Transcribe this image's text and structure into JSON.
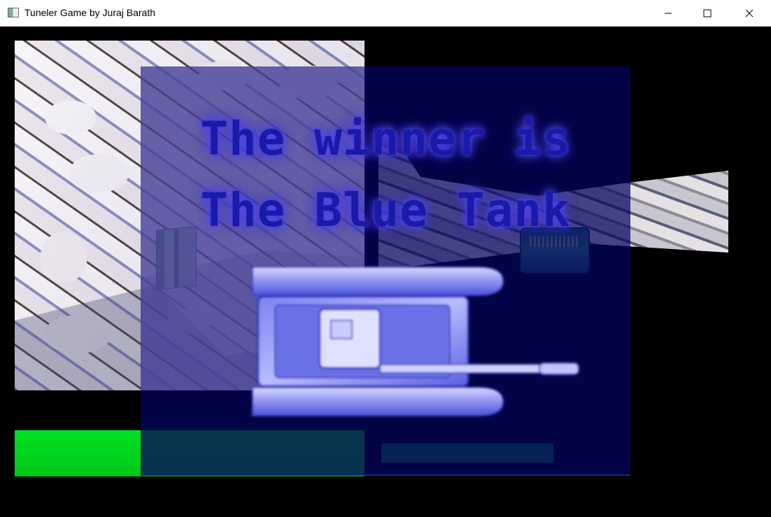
{
  "window": {
    "title": "Tuneler Game by Juraj Barath",
    "controls": [
      "minimize-icon",
      "maximize-icon",
      "close-icon"
    ]
  },
  "game": {
    "winner_line1": "The winner is",
    "winner_line2": "The Blue Tank",
    "colors": {
      "overlay": "#04065f",
      "winner_text": "#1a1aa8",
      "energy_left": "#00d91c",
      "energy_right": "#0f6a3b",
      "background": "#000000"
    },
    "players": [
      {
        "view": "left",
        "energy_fraction": 1.0
      },
      {
        "view": "right",
        "energy_fraction": 0.49
      }
    ]
  }
}
